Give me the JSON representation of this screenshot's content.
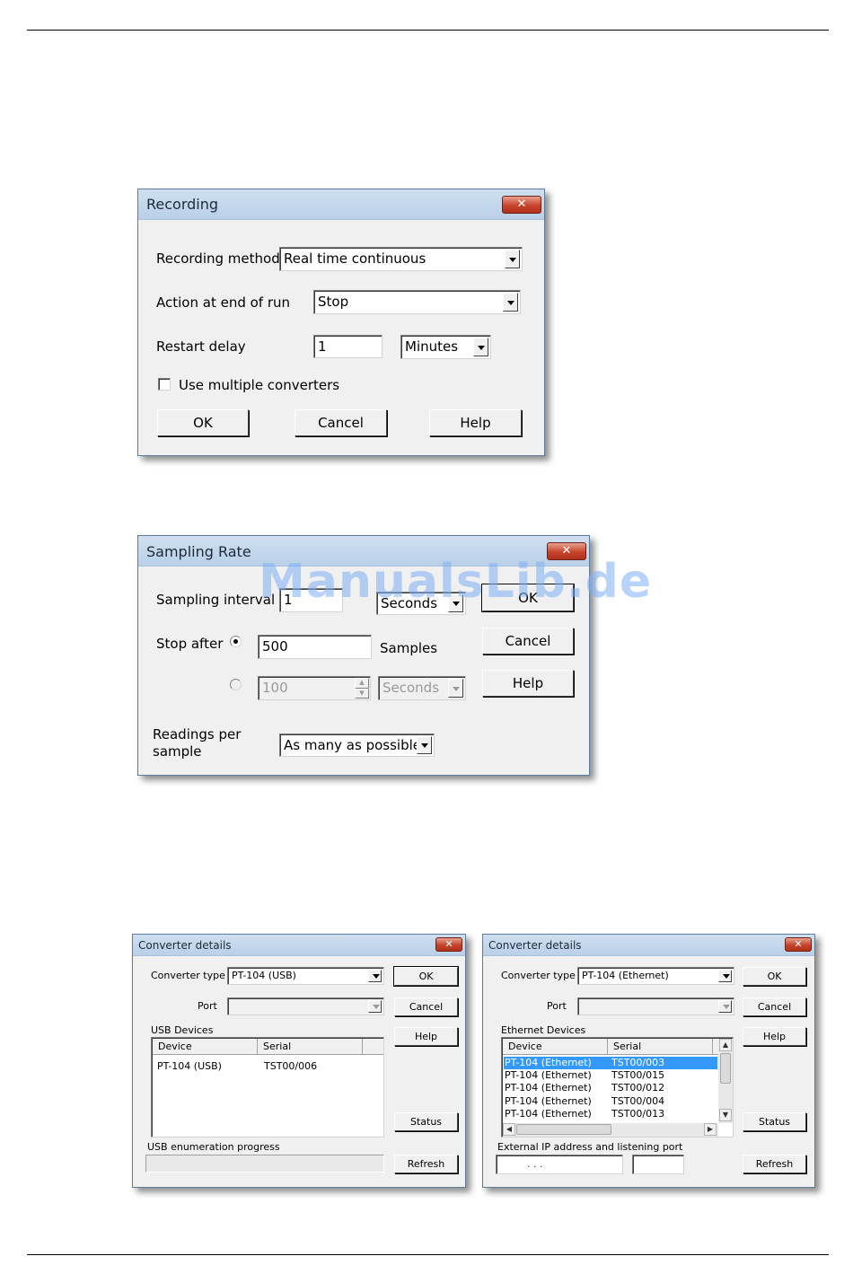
{
  "recording": {
    "title": "Recording",
    "close": "✕",
    "method_label": "Recording method",
    "method_value": "Real time continuous",
    "action_label": "Action at end of run",
    "action_value": "Stop",
    "restart_label": "Restart delay",
    "restart_value": "1",
    "restart_unit": "Minutes",
    "multi_label": "Use multiple converters",
    "ok": "OK",
    "cancel": "Cancel",
    "help": "Help"
  },
  "sampling": {
    "title": "Sampling Rate",
    "close": "✕",
    "interval_label": "Sampling interval",
    "interval_value": "1",
    "interval_unit": "Seconds",
    "stop_label": "Stop after",
    "samples_value": "500",
    "samples_unit": "Samples",
    "time_value": "100",
    "time_unit": "Seconds",
    "readings_label_1": "Readings per",
    "readings_label_2": "sample",
    "readings_value": "As many as possible",
    "ok": "OK",
    "cancel": "Cancel",
    "help": "Help"
  },
  "watermark": "ManualsLib.de",
  "usb": {
    "title": "Converter details",
    "close": "✕",
    "type_label": "Converter type",
    "type_value": "PT-104 (USB)",
    "port_label": "Port",
    "devices_label": "USB Devices",
    "col_device": "Device",
    "col_serial": "Serial",
    "rows": [
      {
        "device": "PT-104 (USB)",
        "serial": "TST00/006"
      }
    ],
    "progress_label": "USB enumeration progress",
    "ok": "OK",
    "cancel": "Cancel",
    "help": "Help",
    "status": "Status",
    "refresh": "Refresh"
  },
  "eth": {
    "title": "Converter details",
    "close": "✕",
    "type_label": "Converter type",
    "type_value": "PT-104 (Ethernet)",
    "port_label": "Port",
    "devices_label": "Ethernet Devices",
    "col_device": "Device",
    "col_serial": "Serial",
    "rows": [
      {
        "device": "PT-104 (Ethernet)",
        "serial": "TST00/003"
      },
      {
        "device": "PT-104 (Ethernet)",
        "serial": "TST00/015"
      },
      {
        "device": "PT-104 (Ethernet)",
        "serial": "TST00/012"
      },
      {
        "device": "PT-104 (Ethernet)",
        "serial": "TST00/004"
      },
      {
        "device": "PT-104 (Ethernet)",
        "serial": "TST00/013"
      }
    ],
    "ip_label": "External IP address and listening port",
    "ip_value": ".       .       .",
    "ok": "OK",
    "cancel": "Cancel",
    "help": "Help",
    "status": "Status",
    "refresh": "Refresh"
  }
}
